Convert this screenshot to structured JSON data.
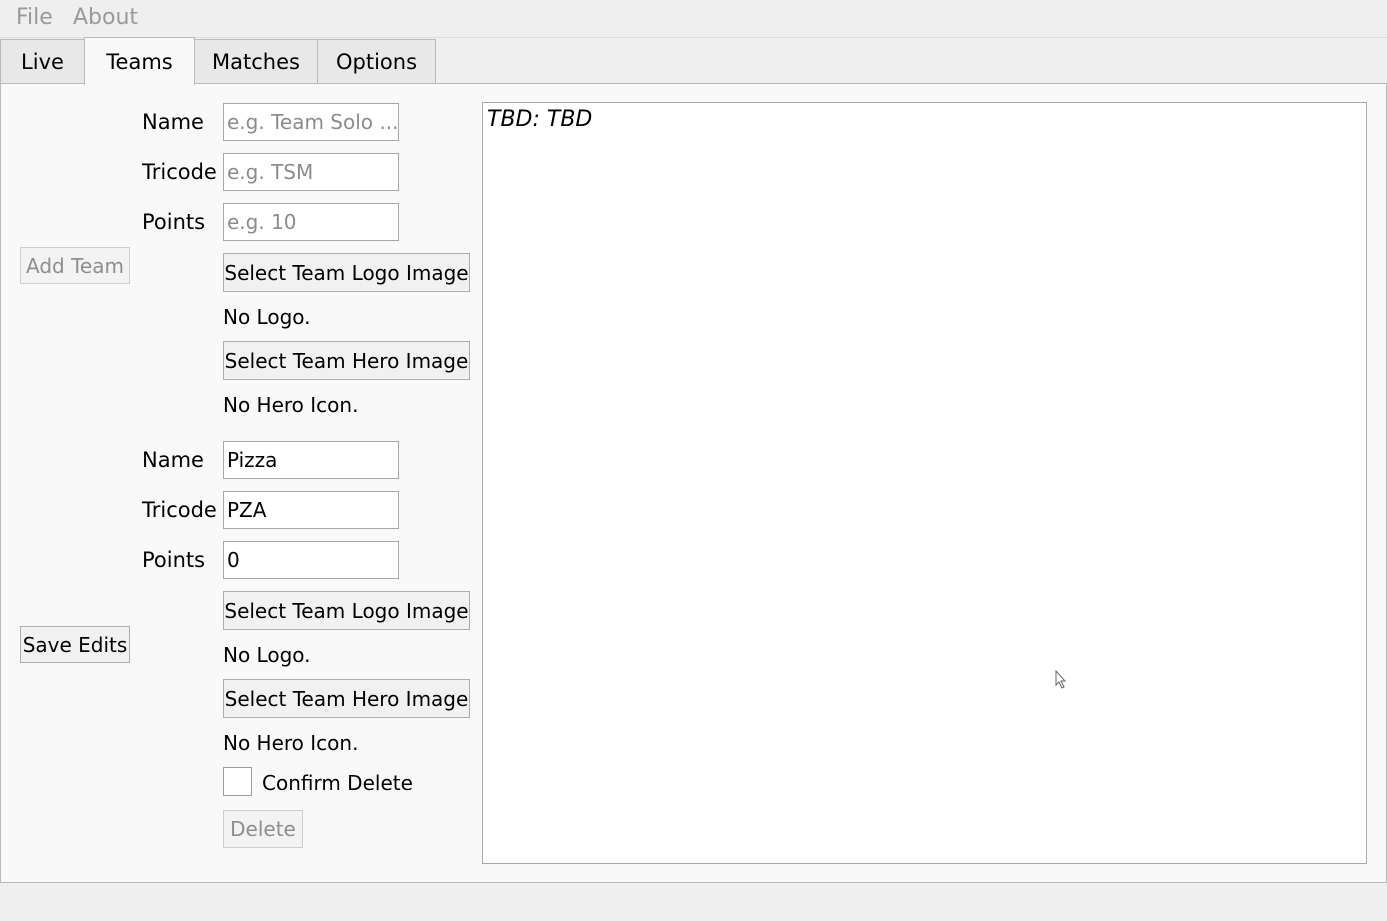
{
  "menu": [
    "File",
    "About"
  ],
  "tabs": [
    "Live",
    "Teams",
    "Matches",
    "Options"
  ],
  "active_tab": "Teams",
  "new_team": {
    "name_label": "Name",
    "name_placeholder": "e.g. Team Solo ...",
    "tricode_label": "Tricode",
    "tricode_placeholder": "e.g. TSM",
    "points_label": "Points",
    "points_placeholder": "e.g. 10",
    "logo_button": "Select Team Logo Image",
    "logo_status": "No Logo.",
    "hero_button": "Select Team Hero Image",
    "hero_status": "No Hero Icon.",
    "add_button": "Add Team"
  },
  "edit_team": {
    "name_label": "Name",
    "name_value": "Pizza",
    "tricode_label": "Tricode",
    "tricode_value": "PZA",
    "points_label": "Points",
    "points_value": "0",
    "logo_button": "Select Team Logo Image",
    "logo_status": "No Logo.",
    "hero_button": "Select Team Hero Image",
    "hero_status": "No Hero Icon.",
    "save_button": "Save Edits",
    "confirm_delete_label": "Confirm Delete",
    "confirm_delete_checked": false,
    "delete_button": "Delete"
  },
  "preview": {
    "text": "TBD: TBD"
  }
}
